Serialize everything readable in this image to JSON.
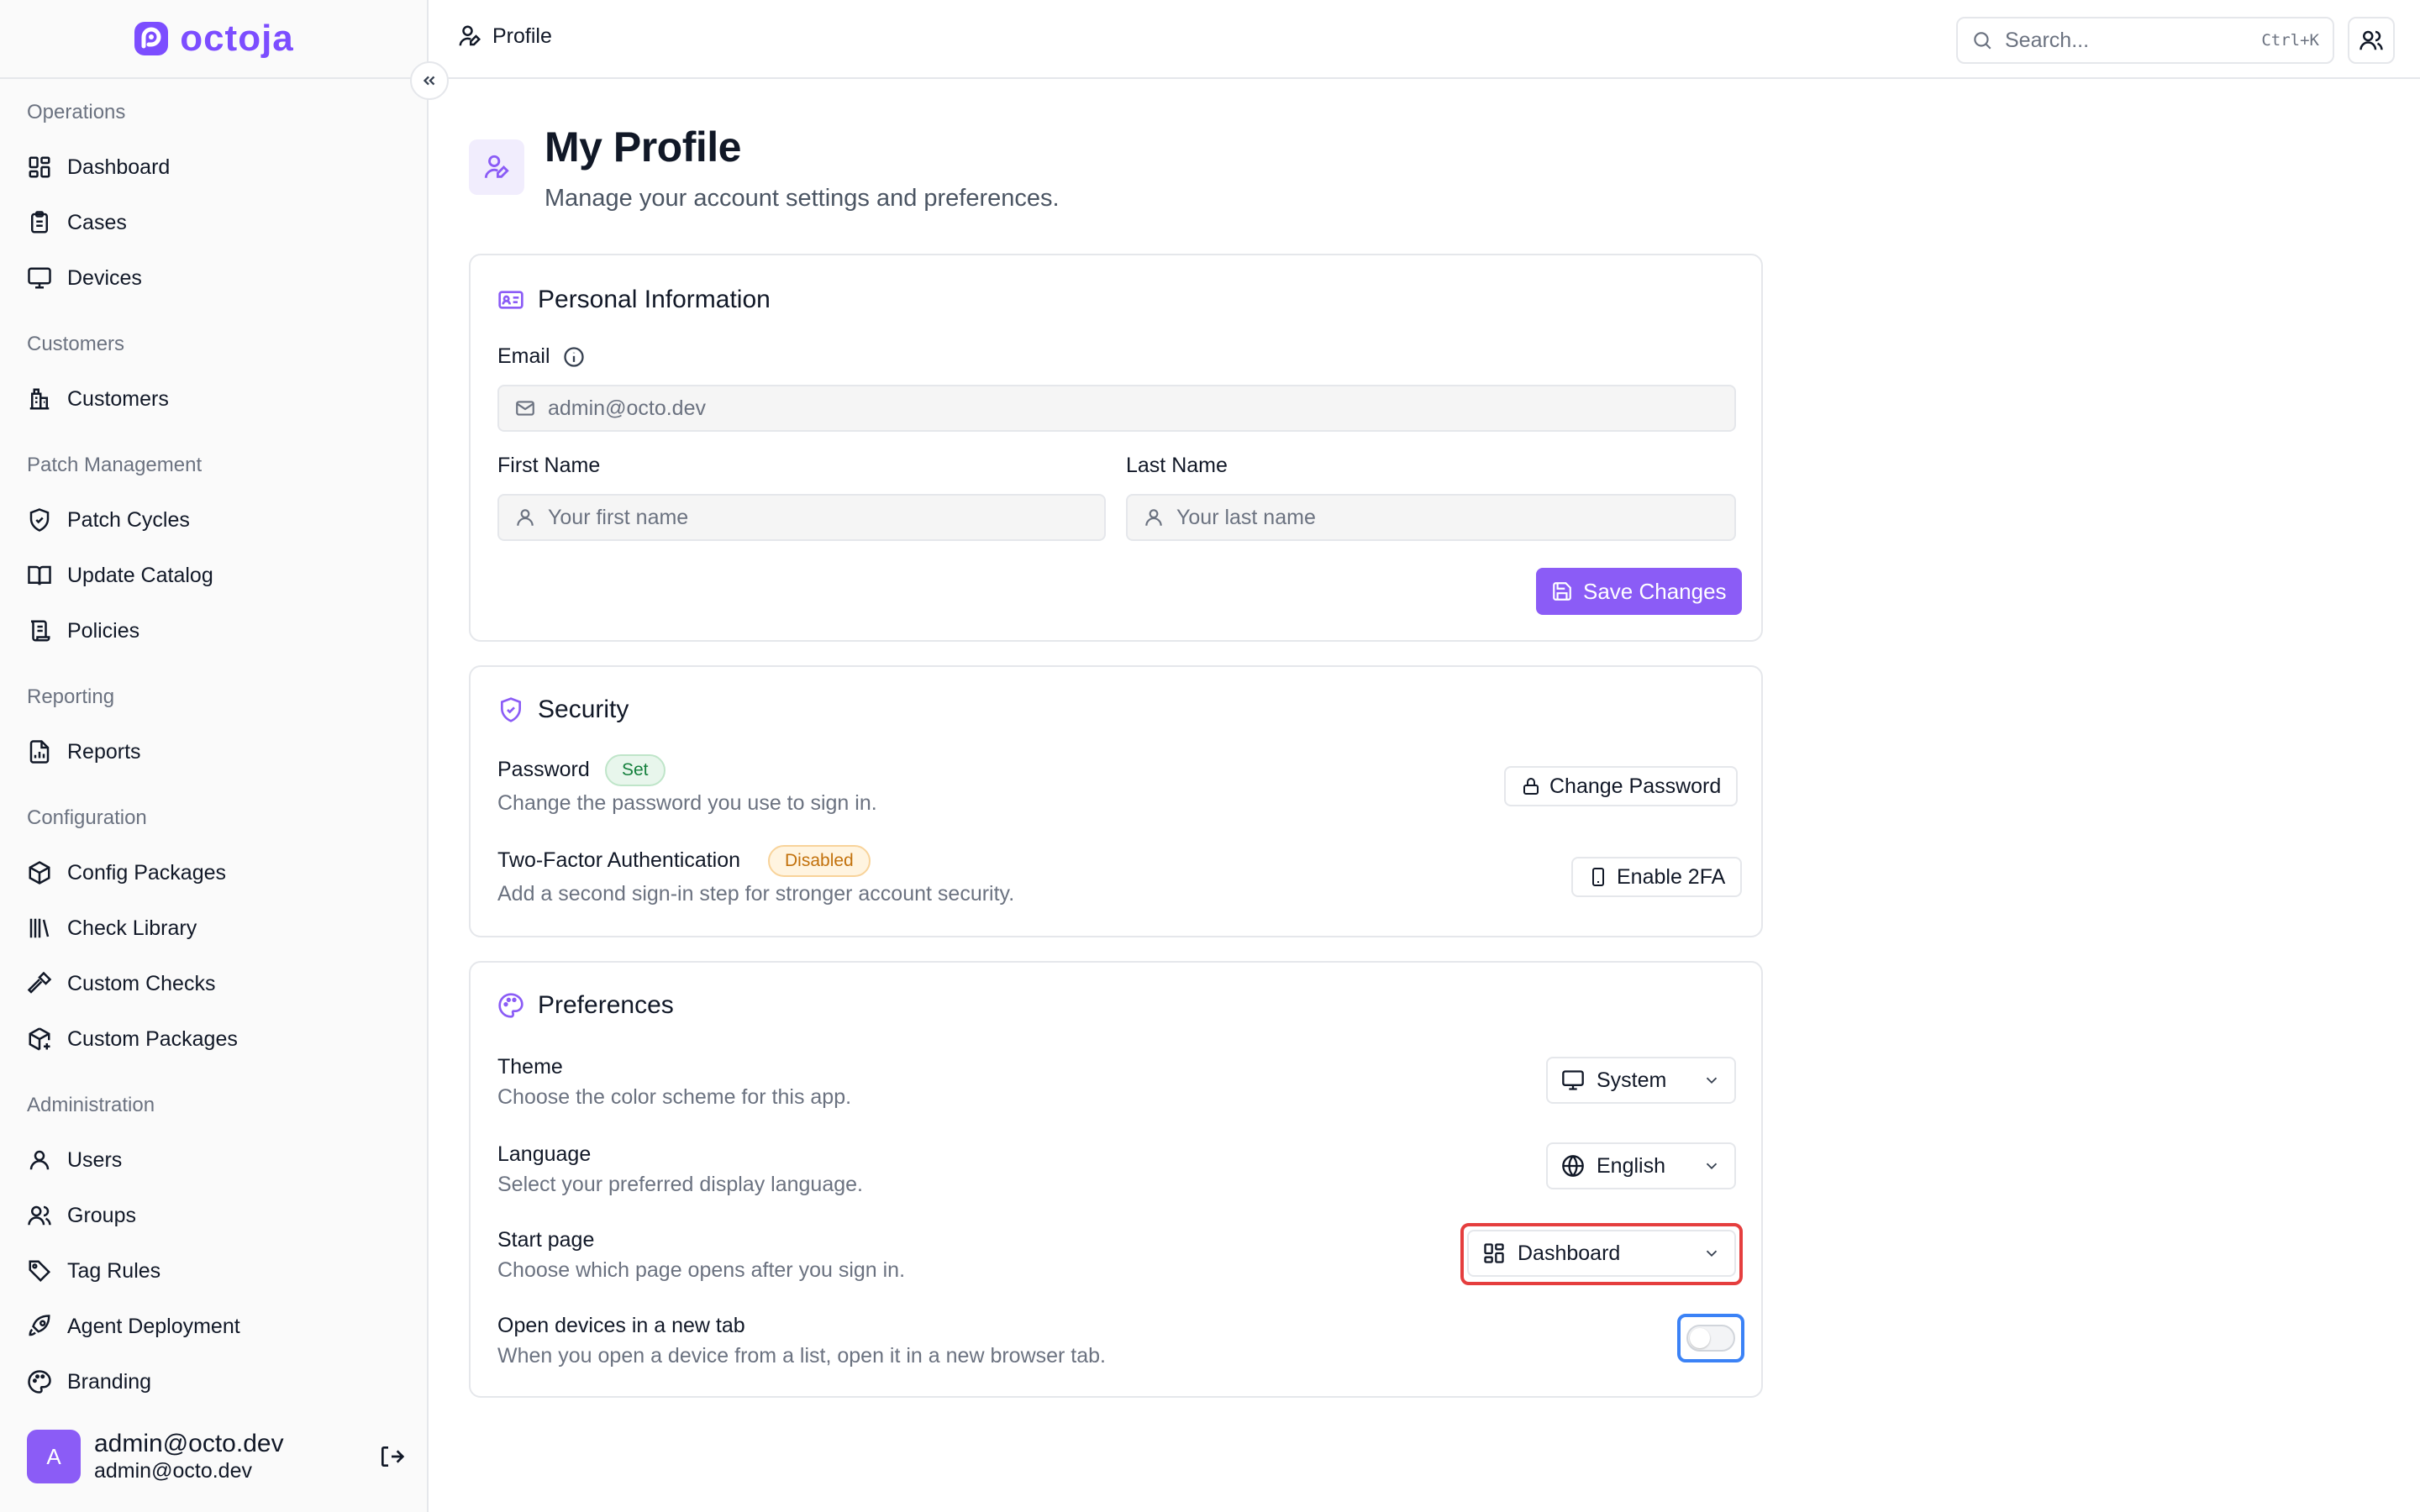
{
  "brand": {
    "name": "octoja",
    "color": "#7c4dff"
  },
  "sidebar": {
    "sections": [
      {
        "title": "Operations",
        "items": [
          {
            "label": "Dashboard",
            "icon": "dashboard-icon"
          },
          {
            "label": "Cases",
            "icon": "clipboard-icon"
          },
          {
            "label": "Devices",
            "icon": "monitor-icon"
          }
        ]
      },
      {
        "title": "Customers",
        "items": [
          {
            "label": "Customers",
            "icon": "building-icon"
          }
        ]
      },
      {
        "title": "Patch Management",
        "items": [
          {
            "label": "Patch Cycles",
            "icon": "shield-icon"
          },
          {
            "label": "Update Catalog",
            "icon": "book-icon"
          },
          {
            "label": "Policies",
            "icon": "scroll-icon"
          }
        ]
      },
      {
        "title": "Reporting",
        "items": [
          {
            "label": "Reports",
            "icon": "report-icon"
          }
        ]
      },
      {
        "title": "Configuration",
        "items": [
          {
            "label": "Config Packages",
            "icon": "package-icon"
          },
          {
            "label": "Check Library",
            "icon": "library-icon"
          },
          {
            "label": "Custom Checks",
            "icon": "hammer-icon"
          },
          {
            "label": "Custom Packages",
            "icon": "package-plus-icon"
          }
        ]
      },
      {
        "title": "Administration",
        "items": [
          {
            "label": "Users",
            "icon": "user-icon"
          },
          {
            "label": "Groups",
            "icon": "users-icon"
          },
          {
            "label": "Tag Rules",
            "icon": "tag-icon"
          },
          {
            "label": "Agent Deployment",
            "icon": "rocket-icon"
          },
          {
            "label": "Branding",
            "icon": "palette-icon"
          }
        ]
      }
    ],
    "user": {
      "initial": "A",
      "name": "admin@octo.dev",
      "email": "admin@octo.dev"
    }
  },
  "topbar": {
    "breadcrumb": "Profile",
    "search_placeholder": "Search...",
    "search_shortcut": "Ctrl+K"
  },
  "page": {
    "title": "My Profile",
    "subtitle": "Manage your account settings and preferences."
  },
  "personal": {
    "title": "Personal Information",
    "email_label": "Email",
    "email_value": "admin@octo.dev",
    "first_label": "First Name",
    "first_placeholder": "Your first name",
    "last_label": "Last Name",
    "last_placeholder": "Your last name",
    "save_label": "Save Changes"
  },
  "security": {
    "title": "Security",
    "password_label": "Password",
    "password_badge": "Set",
    "password_desc": "Change the password you use to sign in.",
    "change_password_label": "Change Password",
    "twofa_label": "Two-Factor Authentication",
    "twofa_badge": "Disabled",
    "twofa_desc": "Add a second sign-in step for stronger account security.",
    "enable_2fa_label": "Enable 2FA"
  },
  "preferences": {
    "title": "Preferences",
    "theme_label": "Theme",
    "theme_desc": "Choose the color scheme for this app.",
    "theme_value": "System",
    "language_label": "Language",
    "language_desc": "Select your preferred display language.",
    "language_value": "English",
    "start_label": "Start page",
    "start_desc": "Choose which page opens after you sign in.",
    "start_value": "Dashboard",
    "newtab_label": "Open devices in a new tab",
    "newtab_desc": "When you open a device from a list, open it in a new browser tab.",
    "newtab_enabled": false
  },
  "colors": {
    "accent": "#8b5cf6",
    "highlight_red": "#e53e3e",
    "highlight_blue": "#3b82f6"
  }
}
